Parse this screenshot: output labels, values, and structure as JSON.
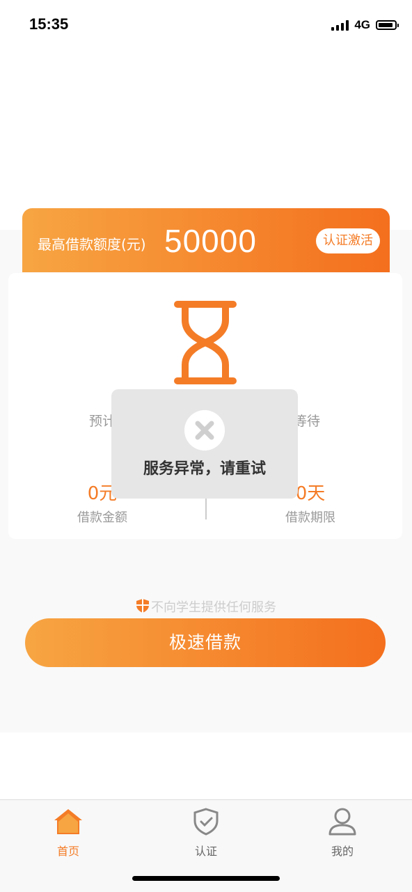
{
  "status_bar": {
    "time": "15:35",
    "network": "4G"
  },
  "quota": {
    "label": "最高借款额度(元)",
    "value": "50000",
    "activate_label": "认证激活"
  },
  "card": {
    "wait_left": "预计",
    "wait_right": "等待",
    "amount": {
      "value": "0元",
      "label": "借款金额"
    },
    "term": {
      "value": "0天",
      "label": "借款期限"
    }
  },
  "notice": "不向学生提供任何服务",
  "loan_button_label": "极速借款",
  "toast": {
    "message": "服务异常，请重试",
    "icon": "close-icon"
  },
  "tabs": [
    {
      "label": "首页",
      "icon": "home-icon",
      "active": true
    },
    {
      "label": "认证",
      "icon": "shield-check-icon",
      "active": false
    },
    {
      "label": "我的",
      "icon": "user-icon",
      "active": false
    }
  ],
  "colors": {
    "accent": "#f47c27",
    "accent_light": "#f7a543"
  }
}
